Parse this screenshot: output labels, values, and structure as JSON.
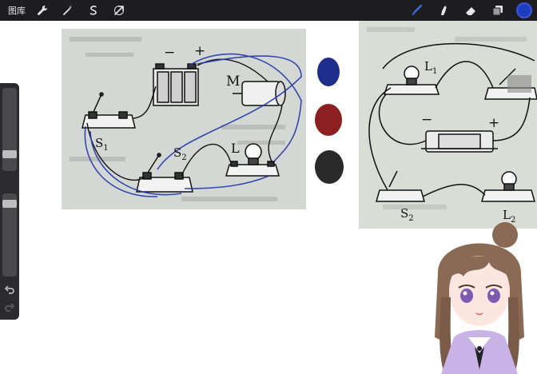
{
  "toolbar": {
    "gallery_label": "图库",
    "left_tools": [
      "wrench-icon",
      "magic-wand-icon",
      "selection-icon",
      "transform-arrow-icon"
    ],
    "right_tools": [
      "brush-icon",
      "smudge-icon",
      "eraser-icon",
      "layers-icon"
    ],
    "current_color": "#1d3fbf"
  },
  "figure_left": {
    "labels": {
      "minus": "−",
      "plus": "+",
      "motor": "M",
      "switch1": "S",
      "switch1_sub": "1",
      "switch2": "S",
      "switch2_sub": "2",
      "lamp": "L"
    }
  },
  "figure_right": {
    "labels": {
      "lamp1": "L",
      "lamp1_sub": "1",
      "minus": "−",
      "plus": "+",
      "switch2": "S",
      "switch2_sub": "2",
      "lamp2": "L",
      "lamp2_sub": "2"
    }
  },
  "swatches": [
    {
      "name": "blue",
      "color": "#1f2e8c"
    },
    {
      "name": "red",
      "color": "#8c1f1f"
    },
    {
      "name": "black",
      "color": "#2a2a2a"
    }
  ]
}
